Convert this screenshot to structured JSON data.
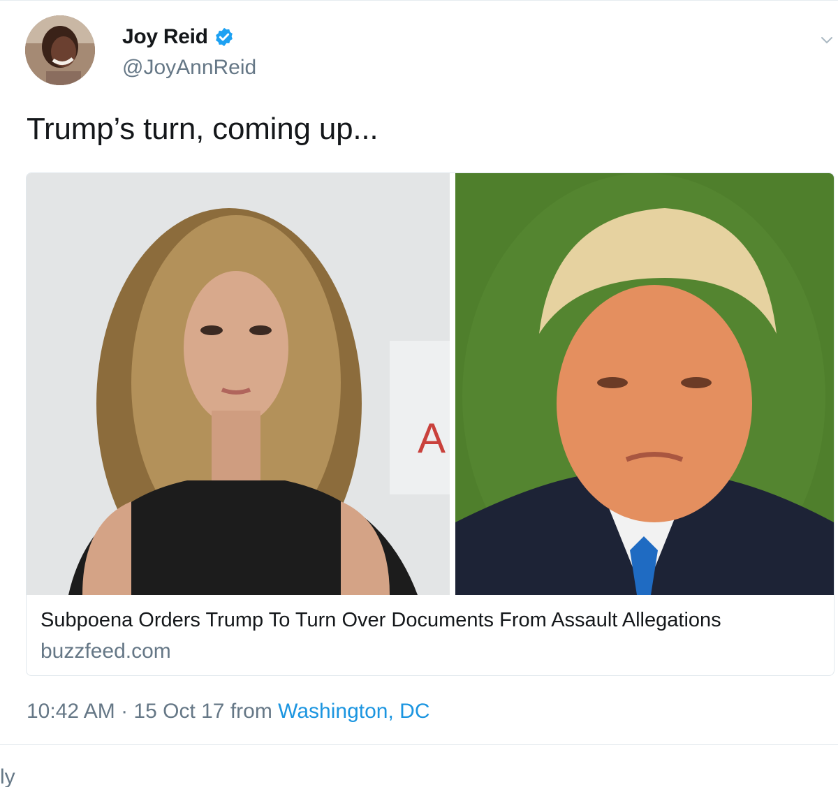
{
  "author": {
    "display_name": "Joy Reid",
    "handle": "@JoyAnnReid",
    "verified": true,
    "avatar_icon": "profile-photo"
  },
  "tweet": {
    "text": "Trump’s turn, coming up...",
    "card": {
      "title": "Subpoena Orders Trump To Turn Over Documents From Assault Allegations",
      "domain": "buzzfeed.com",
      "images": [
        "woman-curly-hair-photo",
        "man-suit-green-background-photo"
      ]
    },
    "timestamp": "10:42 AM · 15 Oct 17 from ",
    "location": "Washington, DC"
  },
  "footer": {
    "reply_fragment": "ly"
  },
  "colors": {
    "text_primary": "#14171a",
    "text_secondary": "#657786",
    "link": "#1b95e0",
    "verified": "#1da1f2",
    "border": "#e1e8ed"
  }
}
